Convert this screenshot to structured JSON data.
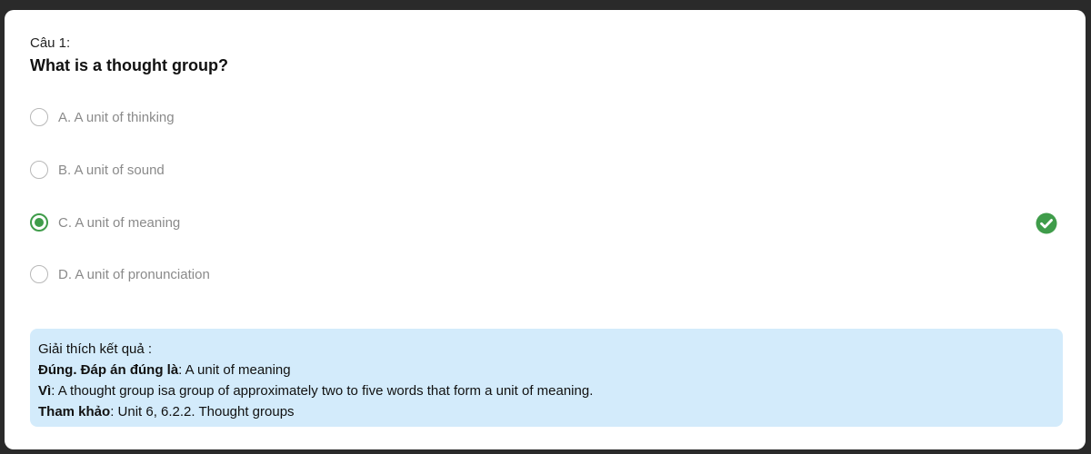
{
  "question": {
    "number_label": "Câu 1:",
    "text": "What is a thought group?"
  },
  "options": [
    {
      "label": "A. A unit of thinking",
      "selected": false
    },
    {
      "label": "B. A unit of sound",
      "selected": false
    },
    {
      "label": "C. A unit of meaning",
      "selected": true,
      "correct_icon": "check-circle-icon"
    },
    {
      "label": "D. A unit of pronunciation",
      "selected": false
    }
  ],
  "explanation": {
    "heading": "Giải thích kết quả :",
    "answer_label": "Đúng. Đáp án đúng là",
    "answer_value": ": A unit of meaning",
    "reason_label": "Vì",
    "reason_value": ": A thought group isa group of approximately two to five words that form a unit of meaning.",
    "ref_label": "Tham khảo",
    "ref_value": ": Unit 6, 6.2.2. Thought groups"
  },
  "colors": {
    "correct": "#3f9c4a",
    "explanation_bg": "#d3ebfb",
    "page_bg": "#2a2a2a"
  }
}
